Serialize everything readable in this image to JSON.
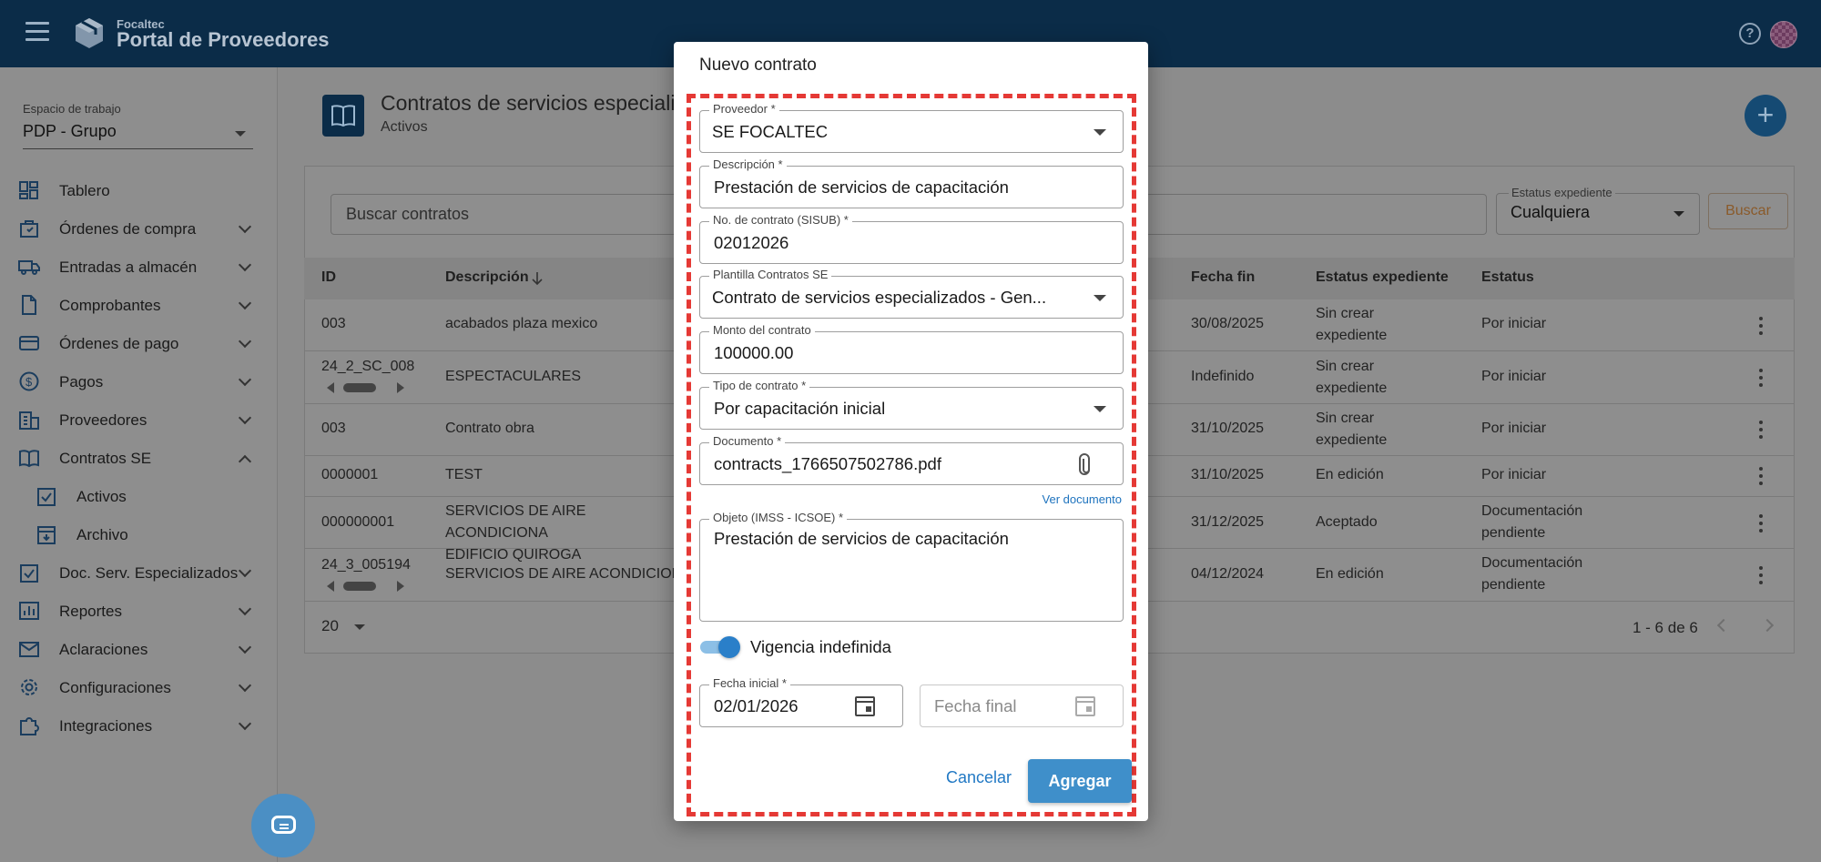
{
  "header": {
    "brand_small": "Focaltec",
    "brand_title": "Portal de Proveedores"
  },
  "sidebar": {
    "workspace_label": "Espacio de trabajo",
    "workspace_value": "PDP - Grupo",
    "items": [
      {
        "label": "Tablero",
        "icon": "dashboard-icon"
      },
      {
        "label": "Órdenes de compra",
        "icon": "orders-icon"
      },
      {
        "label": "Entradas a almacén",
        "icon": "truck-icon"
      },
      {
        "label": "Comprobantes",
        "icon": "document-icon"
      },
      {
        "label": "Órdenes de pago",
        "icon": "credit-card-icon"
      },
      {
        "label": "Pagos",
        "icon": "dollar-icon"
      },
      {
        "label": "Proveedores",
        "icon": "building-icon"
      },
      {
        "label": "Contratos SE",
        "icon": "book-icon"
      },
      {
        "label": "Doc. Serv. Especializados",
        "icon": "clipboard-check-icon"
      },
      {
        "label": "Reportes",
        "icon": "chart-icon"
      },
      {
        "label": "Aclaraciones",
        "icon": "mail-icon"
      },
      {
        "label": "Configuraciones",
        "icon": "gear-icon"
      },
      {
        "label": "Integraciones",
        "icon": "puzzle-icon"
      }
    ],
    "subitems": [
      {
        "label": "Activos",
        "icon": "clipboard-check-icon"
      },
      {
        "label": "Archivo",
        "icon": "archive-icon"
      }
    ]
  },
  "main": {
    "title": "Contratos de servicios especializ",
    "subtitle": "Activos",
    "search_placeholder": "Buscar contratos",
    "status_filter_label": "Estatus expediente",
    "status_filter_value": "Cualquiera",
    "search_button": "Buscar",
    "fab_label": "+",
    "columns": [
      "ID",
      "Descripción",
      "Fecha fin",
      "Estatus expediente",
      "Estatus"
    ],
    "rows": [
      {
        "id": "003",
        "desc": "acabados plaza mexico",
        "fecha_fin": "30/08/2025",
        "expediente": "Sin crear\nexpediente",
        "estatus": "Por iniciar"
      },
      {
        "id": "24_2_SC_008",
        "desc": "ESPECTACULARES",
        "fecha_fin": "Indefinido",
        "expediente": "Sin crear\nexpediente",
        "estatus": "Por iniciar"
      },
      {
        "id": "003",
        "desc": "Contrato obra",
        "fecha_fin": "31/10/2025",
        "expediente": "Sin crear\nexpediente",
        "estatus": "Por iniciar"
      },
      {
        "id": "0000001",
        "desc": "TEST",
        "fecha_fin": "31/10/2025",
        "expediente": "En edición",
        "estatus": "Por iniciar"
      },
      {
        "id": "000000001",
        "desc": "SERVICIOS DE AIRE ACONDICIONA\nEDIFICIO QUIROGA",
        "fecha_fin": "31/12/2025",
        "expediente": "Aceptado",
        "estatus": "Documentación\npendiente"
      },
      {
        "id": "24_3_005194",
        "desc": "SERVICIOS DE AIRE ACONDICIONA",
        "fecha_fin": "04/12/2024",
        "expediente": "En edición",
        "estatus": "Documentación\npendiente"
      }
    ],
    "page_size": "20",
    "page_range": "1 - 6 de 6"
  },
  "modal": {
    "title": "Nuevo contrato",
    "proveedor_label": "Proveedor *",
    "proveedor_value": "SE FOCALTEC",
    "descripcion_label": "Descripción *",
    "descripcion_value": "Prestación de servicios de capacitación",
    "contrato_label": "No. de contrato (SISUB) *",
    "contrato_value": "02012026",
    "plantilla_label": "Plantilla Contratos SE",
    "plantilla_value": "Contrato de servicios especializados - Gen...",
    "monto_label": "Monto del contrato",
    "monto_value": "100000.00",
    "tipo_label": "Tipo de contrato *",
    "tipo_value": "Por capacitación inicial",
    "documento_label": "Documento *",
    "documento_value": "contracts_1766507502786.pdf",
    "ver_documento": "Ver documento",
    "objeto_label": "Objeto (IMSS - ICSOE) *",
    "objeto_value": "Prestación de servicios de capacitación",
    "vigencia_label": "Vigencia indefinida",
    "vigencia_on": true,
    "fecha_inicial_label": "Fecha inicial *",
    "fecha_inicial_value": "02/01/2026",
    "fecha_final_placeholder": "Fecha final",
    "cancel": "Cancelar",
    "add": "Agregar"
  },
  "colors": {
    "topbar": "#0b2c48",
    "accent": "#3f8fca",
    "highlight": "#e53935"
  }
}
